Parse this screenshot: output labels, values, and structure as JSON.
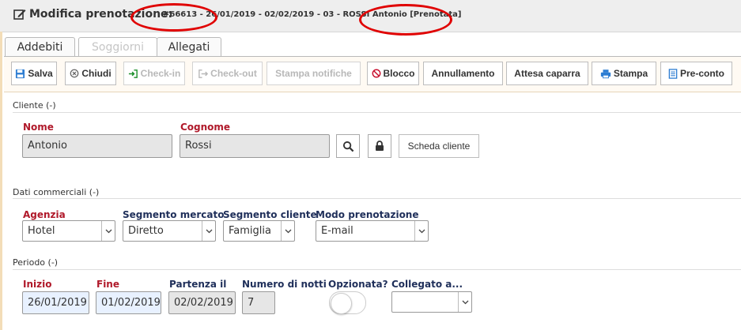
{
  "header": {
    "title": "Modifica prenotazione:",
    "subtitle": "#66613 - 26/01/2019 - 02/02/2019 - 03 - ROSSI Antonio [Prenotata]",
    "edit_icon": "edit-icon",
    "annotation_color": "#e00000"
  },
  "tabs": [
    {
      "label": "Addebiti",
      "enabled": true
    },
    {
      "label": "Soggiorni",
      "enabled": false
    },
    {
      "label": "Allegati",
      "enabled": true
    }
  ],
  "toolbar": {
    "save": "Salva",
    "close": "Chiudi",
    "checkin": "Check-in",
    "checkout": "Check-out",
    "print_notices": "Stampa notifiche",
    "block": "Blocco",
    "cancel": "Annullamento",
    "wait_deposit": "Attesa caparra",
    "print": "Stampa",
    "pre_account": "Pre-conto"
  },
  "client": {
    "section": "Cliente (-)",
    "name_label": "Nome",
    "name_value": "Antonio",
    "surname_label": "Cognome",
    "surname_value": "Rossi",
    "card_button": "Scheda cliente"
  },
  "commercial": {
    "section": "Dati commerciali (-)",
    "agency_label": "Agenzia",
    "agency_value": "Hotel",
    "market_label": "Segmento mercato",
    "market_value": "Diretto",
    "client_segment_label": "Segmento cliente",
    "client_segment_value": "Famiglia",
    "mode_label": "Modo prenotazione",
    "mode_value": "E-mail"
  },
  "period": {
    "section": "Periodo (-)",
    "start_label": "Inizio",
    "start_value": "26/01/2019",
    "end_label": "Fine",
    "end_value": "01/02/2019",
    "departure_label": "Partenza il",
    "departure_value": "02/02/2019",
    "nights_label": "Numero di notti",
    "nights_value": "7",
    "optioned_label": "Opzionata?",
    "optioned_value": false,
    "linked_label": "Collegato a...",
    "linked_value": ""
  }
}
